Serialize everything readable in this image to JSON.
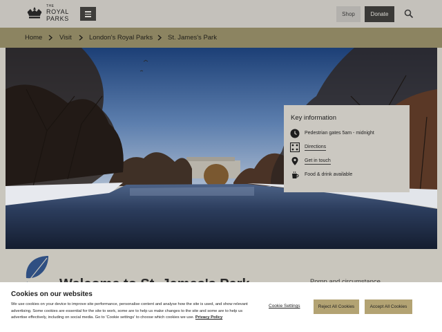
{
  "header": {
    "logo": {
      "the": "THE",
      "royal": "ROYAL",
      "parks": "PARKS"
    },
    "menu_icon": "hamburger-icon",
    "shop_label": "Shop",
    "donate_label": "Donate",
    "search_icon": "search-icon"
  },
  "breadcrumb": {
    "items": [
      "Home",
      "Visit",
      "London's Royal Parks",
      "St. James's Park"
    ],
    "separator_icon": "chevron-right-icon"
  },
  "key_info": {
    "title": "Key information",
    "items": [
      {
        "icon": "clock-icon",
        "label": "Pedestrian gates 5am - midnight"
      },
      {
        "icon": "directions-icon",
        "label": "Directions"
      },
      {
        "icon": "location-pin-icon",
        "label": "Get in touch"
      },
      {
        "icon": "cup-icon",
        "label": "Food & drink available"
      }
    ]
  },
  "main": {
    "welcome_partial": "Welcome to St. James's Park",
    "side_partial": "Pomp and circumstance"
  },
  "cookie_banner": {
    "title": "Cookies on our websites",
    "text": "We use cookies on your device to improve site performance, personalise content and analyse how the site is used, and show relevant advertising. Some cookies are essential for the site to work, some are to help us make changes to the site and some are to help us advertise effectively, including on social media. Go to 'Cookie settings' to choose which cookies we use.",
    "privacy_link": "Privacy Policy",
    "settings_label": "Cookie Settings",
    "reject_label": "Reject All Cookies",
    "accept_label": "Accept All Cookies"
  },
  "colors": {
    "header_bg": "#c4c1bb",
    "breadcrumb_bg": "#8c8461",
    "accent_gold": "#b3a373",
    "dark_button": "#3a3937",
    "panel_bg": "#cbc8c1",
    "cookie_bg": "#ffffff"
  }
}
